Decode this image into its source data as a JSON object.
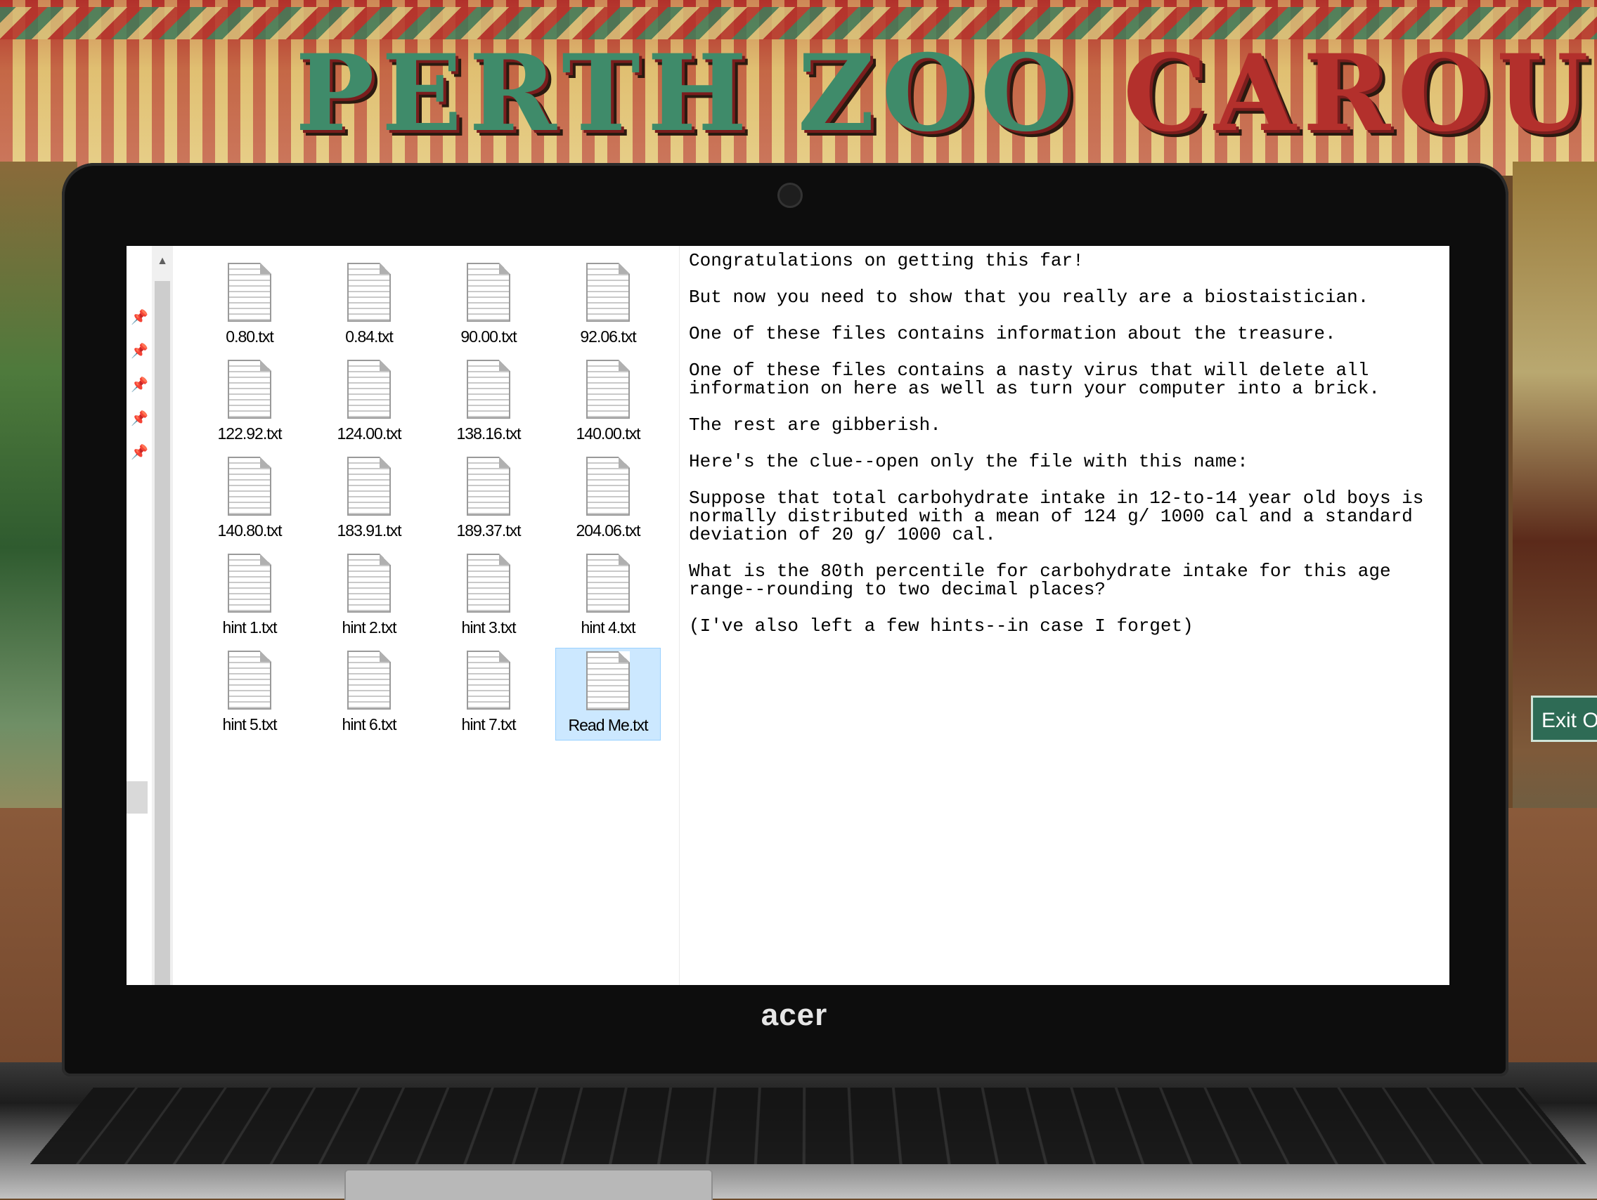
{
  "background": {
    "sign_word_1": "PERTH ZOO",
    "sign_word_2": "CAROUSE",
    "exit_sign": "Exit Or"
  },
  "laptop": {
    "brand": "acer"
  },
  "explorer": {
    "files": [
      {
        "name": "0.80.txt",
        "selected": false
      },
      {
        "name": "0.84.txt",
        "selected": false
      },
      {
        "name": "90.00.txt",
        "selected": false
      },
      {
        "name": "92.06.txt",
        "selected": false
      },
      {
        "name": "122.92.txt",
        "selected": false
      },
      {
        "name": "124.00.txt",
        "selected": false
      },
      {
        "name": "138.16.txt",
        "selected": false
      },
      {
        "name": "140.00.txt",
        "selected": false
      },
      {
        "name": "140.80.txt",
        "selected": false
      },
      {
        "name": "183.91.txt",
        "selected": false
      },
      {
        "name": "189.37.txt",
        "selected": false
      },
      {
        "name": "204.06.txt",
        "selected": false
      },
      {
        "name": "hint 1.txt",
        "selected": false
      },
      {
        "name": "hint 2.txt",
        "selected": false
      },
      {
        "name": "hint 3.txt",
        "selected": false
      },
      {
        "name": "hint 4.txt",
        "selected": false
      },
      {
        "name": "hint 5.txt",
        "selected": false
      },
      {
        "name": "hint 6.txt",
        "selected": false
      },
      {
        "name": "hint 7.txt",
        "selected": false
      },
      {
        "name": "Read Me.txt",
        "selected": true
      }
    ]
  },
  "preview": {
    "paragraphs": [
      "Congratulations on getting this far!",
      "But now you need to show that you really are a biostaistician.",
      "One of these files contains information about the treasure.",
      "One of these files contains a nasty virus that will delete all\ninformation on here as well as turn your computer into a brick.",
      "The rest are gibberish.",
      "Here's the clue--open only the file with this name:",
      "Suppose that total carbohydrate intake in 12-to-14 year old boys is\nnormally distributed with a mean of 124 g/ 1000 cal and a standard\ndeviation of 20 g/ 1000 cal.",
      "What is the 80th percentile for carbohydrate intake for this age\nrange--rounding to two decimal places?",
      "(I've also left a few hints--in case I forget)"
    ]
  }
}
